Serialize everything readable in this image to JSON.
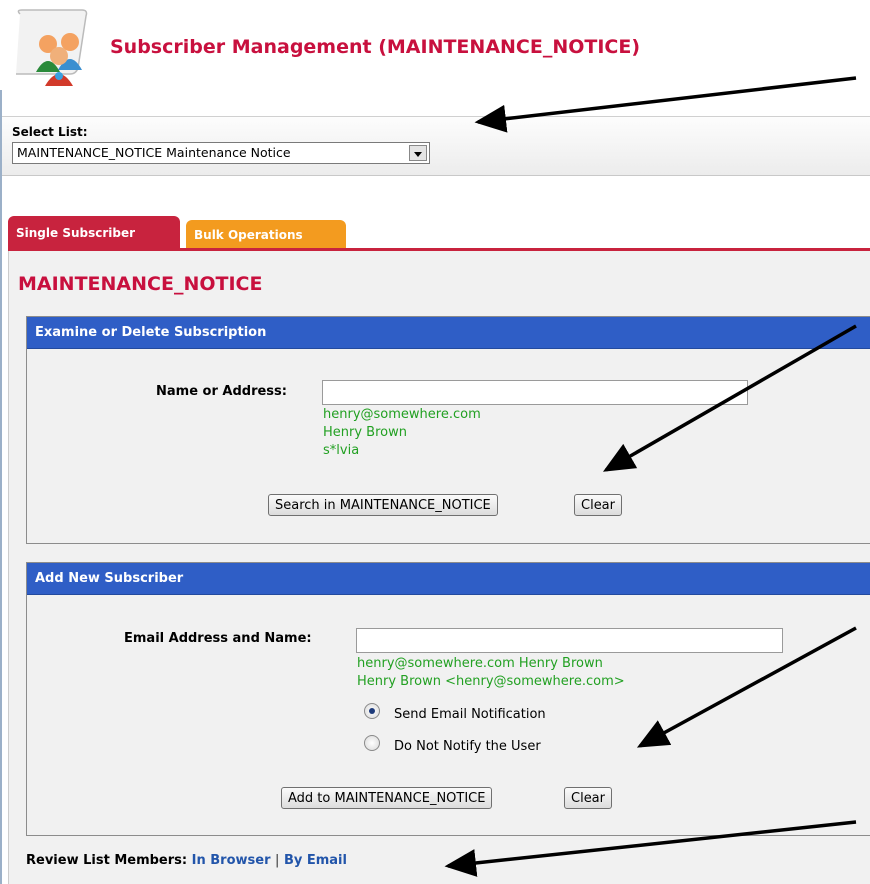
{
  "header": {
    "title": "Subscriber Management (MAINTENANCE_NOTICE)",
    "logo_icon": "users-group-icon"
  },
  "select": {
    "label": "Select List:",
    "value": "MAINTENANCE_NOTICE Maintenance Notice"
  },
  "tabs": [
    {
      "label": "Single Subscriber"
    },
    {
      "label": "Bulk Operations"
    }
  ],
  "list_title": "MAINTENANCE_NOTICE",
  "examine": {
    "heading": "Examine or Delete Subscription",
    "field_label": "Name or Address:",
    "input_value": "",
    "hints": [
      "henry@somewhere.com",
      "Henry Brown",
      "s*lvia"
    ],
    "search_button": "Search in MAINTENANCE_NOTICE",
    "clear_button": "Clear"
  },
  "add": {
    "heading": "Add New Subscriber",
    "field_label": "Email Address and Name:",
    "input_value": "",
    "hints": [
      "henry@somewhere.com Henry Brown",
      "Henry Brown <henry@somewhere.com>"
    ],
    "radio_notify": "Send Email Notification",
    "radio_no_notify": "Do Not Notify the User",
    "add_button": "Add to MAINTENANCE_NOTICE",
    "clear_button": "Clear"
  },
  "review": {
    "label": "Review List Members:",
    "in_browser": "In Browser",
    "separator": "|",
    "by_email": "By Email"
  },
  "colors": {
    "title_red": "#c8103e",
    "section_blue": "#2f5ec6",
    "hint_green": "#22a022",
    "tab_red": "#c8233e",
    "tab_orange": "#f39b1f",
    "link_blue": "#2255aa"
  }
}
